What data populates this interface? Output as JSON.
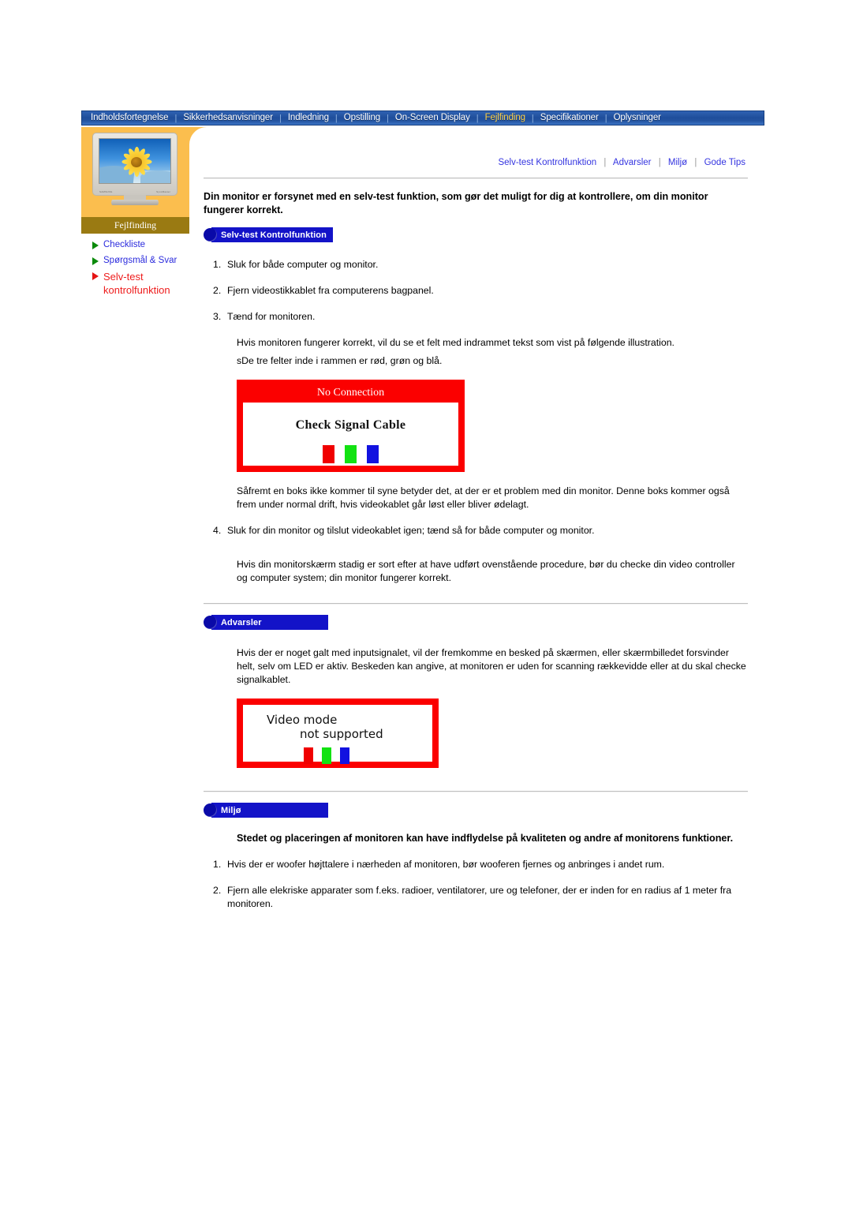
{
  "nav": {
    "items": [
      {
        "label": "Indholdsfortegnelse",
        "active": false
      },
      {
        "label": "Sikkerhedsanvisninger",
        "active": false
      },
      {
        "label": "Indledning",
        "active": false
      },
      {
        "label": "Opstilling",
        "active": false
      },
      {
        "label": "On-Screen Display",
        "active": false
      },
      {
        "label": "Fejlfinding",
        "active": true
      },
      {
        "label": "Specifikationer",
        "active": false
      },
      {
        "label": "Oplysninger",
        "active": false
      }
    ],
    "separator": "|"
  },
  "sidebar": {
    "caption": "Fejlfinding",
    "links": [
      {
        "label": "Checkliste",
        "state": "normal"
      },
      {
        "label": "Spørgsmål & Svar",
        "state": "normal"
      },
      {
        "label": "Selv-test kontrolfunktion",
        "state": "current"
      }
    ]
  },
  "breadcrumb": {
    "items": [
      "Selv-test Kontrolfunktion",
      "Advarsler",
      "Miljø",
      "Gode Tips"
    ],
    "separator": "|"
  },
  "content": {
    "lead": "Din monitor er forsynet med en selv-test funktion, som gør det muligt for dig at kontrollere, om din monitor fungerer korrekt.",
    "selftest": {
      "badge": "Selv-test Kontrolfunktion",
      "steps": [
        {
          "num": "1.",
          "text": "Sluk for både computer og monitor."
        },
        {
          "num": "2.",
          "text": "Fjern videostikkablet fra computerens bagpanel."
        },
        {
          "num": "3.",
          "text": "Tænd for monitoren."
        }
      ],
      "after_step3_a": "Hvis monitoren fungerer korrekt, vil du se et felt med indrammet tekst som vist på følgende illustration.",
      "after_step3_b": "sDe tre felter inde i rammen er rød, grøn og blå.",
      "image1": {
        "title": "No Connection",
        "message": "Check Signal Cable",
        "swatches": [
          "#f00000",
          "#12e212",
          "#1212e0"
        ]
      },
      "para_after_image": "Såfremt en boks ikke kommer til syne betyder det, at der er et problem med din monitor. Denne boks kommer også frem under normal drift, hvis videokablet går løst eller bliver ødelagt.",
      "step4": {
        "num": "4.",
        "text": "Sluk for din monitor og tilslut videokablet igen; tænd så for både computer og monitor."
      },
      "closing": "Hvis din monitorskærm stadig er sort efter at have udført ovenstående procedure, bør du checke din video controller og computer system; din monitor fungerer korrekt."
    },
    "warnings": {
      "badge": "Advarsler",
      "para": "Hvis der er noget galt med inputsignalet, vil der fremkomme en besked på skærmen, eller skærmbilledet forsvinder helt, selv om LED er aktiv. Beskeden kan angive, at monitoren er uden for scanning rækkevidde eller at du skal checke signalkablet.",
      "image2": {
        "line1": "Video mode",
        "line2": "not  supported",
        "swatches": [
          "#f00000",
          "#12e212",
          "#1212e0"
        ]
      }
    },
    "environment": {
      "badge": "Miljø",
      "bold_para": "Stedet og placeringen af monitoren kan have indflydelse på kvaliteten og andre af monitorens funktioner.",
      "items": [
        {
          "num": "1.",
          "text": "Hvis der er woofer højttalere i nærheden af monitoren, bør wooferen fjernes og anbringes i andet rum."
        },
        {
          "num": "2.",
          "text": "Fjern alle elekriske apparater som f.eks. radioer, ventilatorer, ure og telefoner, der er inden for en radius af 1 meter fra monitoren."
        }
      ]
    }
  },
  "colors": {
    "nav_bg": "#1f4e9b",
    "nav_active": "#ffd24a",
    "sidebar_panel": "#fbbe4e",
    "sidebar_caption_bg": "#9a7a12",
    "badge_blue": "#1313c8",
    "link_blue": "#2b2bdd",
    "current_red": "#ee1c1c",
    "box_red": "#fb0000"
  }
}
